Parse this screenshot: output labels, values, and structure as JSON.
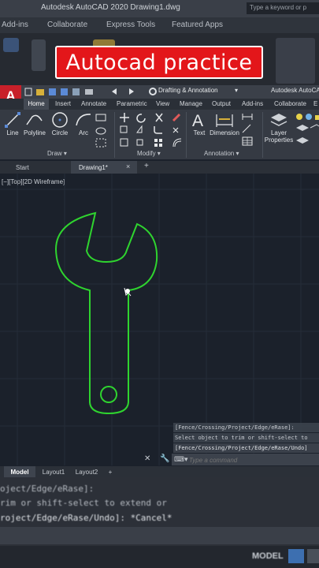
{
  "background_app": {
    "title": "Autodesk AutoCAD 2020   Drawing1.dwg",
    "search_placeholder": "Type a keyword or p",
    "menus": [
      "Add-ins",
      "Collaborate",
      "Express Tools",
      "Featured Apps"
    ]
  },
  "banner": {
    "text": "Autocad practice"
  },
  "window": {
    "workspace": "Drafting & Annotation",
    "title": "Autodesk AutoCA"
  },
  "ribbon_tabs": [
    "Home",
    "Insert",
    "Annotate",
    "Parametric",
    "View",
    "Manage",
    "Output",
    "Add-ins",
    "Collaborate",
    "E"
  ],
  "ribbon": {
    "tools": {
      "line": "Line",
      "polyline": "Polyline",
      "circle": "Circle",
      "arc": "Arc",
      "text": "Text",
      "dimension": "Dimension",
      "layer_properties_1": "Layer",
      "layer_properties_2": "Properties"
    },
    "panels": {
      "draw": "Draw ▾",
      "modify": "Modify ▾",
      "annotation": "Annotation ▾"
    }
  },
  "file_tabs": {
    "start": "Start",
    "drawing": "Drawing1*",
    "close": "×",
    "add": "+"
  },
  "viewport": {
    "label": "[−][Top][2D Wireframe]"
  },
  "drawing": {
    "shape": "wrench",
    "color": "#2fd42f"
  },
  "command": {
    "history": [
      "[Fence/Crossing/Project/Edge/eRase]:",
      "Select object to trim or shift-select to",
      "[Fence/Crossing/Project/Edge/eRase/Undo]"
    ],
    "input_placeholder": "Type a command"
  },
  "layout_tabs": [
    "Model",
    "Layout1",
    "Layout2",
    "+"
  ],
  "zoomed_history": [
    "oject/Edge/eRase]:",
    "rim or shift-select to extend or",
    "roject/Edge/eRase/Undo]: *Cancel*"
  ],
  "status_bar": {
    "model": "MODEL"
  },
  "colors": {
    "accent_red": "#e3161a",
    "logo_red": "#c8202a",
    "wrench_green": "#2fd42f"
  }
}
